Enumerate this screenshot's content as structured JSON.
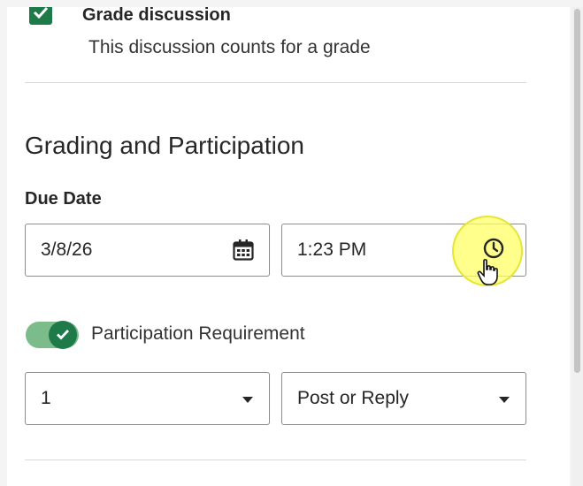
{
  "grade_discussion": {
    "checked": true,
    "title": "Grade discussion",
    "description": "This discussion counts for a grade"
  },
  "grading": {
    "section_title": "Grading and Participation",
    "due_date_label": "Due Date",
    "date_value": "3/8/26",
    "time_value": "1:23 PM",
    "participation": {
      "toggle_on": true,
      "label": "Participation Requirement",
      "count_value": "1",
      "type_value": "Post or Reply"
    }
  },
  "colors": {
    "accent": "#1f7a4a",
    "toggle_track": "#7cbc8b",
    "cursor_highlight": "#ffff66"
  },
  "icons": {
    "checkbox": "checkmark-icon",
    "date": "calendar-icon",
    "time": "clock-icon",
    "toggle": "checkmark-icon",
    "dropdown": "caret-down-icon",
    "cursor": "hand-pointer-icon"
  }
}
